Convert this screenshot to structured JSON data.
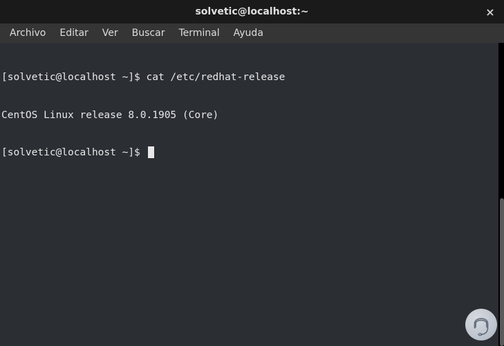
{
  "titlebar": {
    "title": "solvetic@localhost:~",
    "close_glyph": "×"
  },
  "menubar": {
    "items": [
      "Archivo",
      "Editar",
      "Ver",
      "Buscar",
      "Terminal",
      "Ayuda"
    ]
  },
  "terminal": {
    "lines": [
      {
        "prompt": "[solvetic@localhost ~]$ ",
        "command": "cat /etc/redhat-release"
      },
      {
        "output": "CentOS Linux release 8.0.1905 (Core)"
      },
      {
        "prompt": "[solvetic@localhost ~]$ ",
        "command": "",
        "cursor": true
      }
    ]
  }
}
